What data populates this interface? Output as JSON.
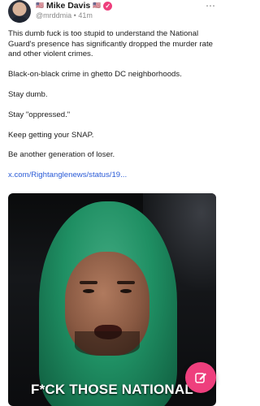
{
  "post": {
    "author": {
      "flag_left": "🇺🇸",
      "name": "Mike Davis",
      "flag_right": "🇺🇸",
      "handle": "@mrddmia",
      "time": "41m",
      "verified_glyph": "✓"
    },
    "more_icon": "more-options-icon",
    "paragraphs": [
      "This dumb fuck is too stupid to understand the National Guard's presence has significantly dropped the murder rate and other violent crimes.",
      "Black-on-black crime in ghetto DC neighborhoods.",
      "Stay dumb.",
      "Stay \"oppressed.\"",
      "Keep getting your SNAP.",
      "Be another generation of loser."
    ],
    "link": "x.com/Rightanglenews/status/19...",
    "video": {
      "caption": "F*CK THOSE NATIONAL"
    }
  },
  "compose_button": {
    "icon": "compose-icon",
    "color": "#ee3f7d"
  },
  "colors": {
    "accent": "#ee3f7d",
    "link": "#2a5bd7"
  }
}
